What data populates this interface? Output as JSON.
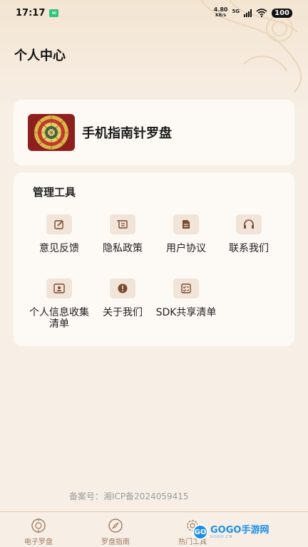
{
  "status_bar": {
    "time": "17:17",
    "net_speed_value": "4.80",
    "net_speed_unit": "KB/s",
    "net_type": "5G",
    "battery": "100"
  },
  "page_title": "个人中心",
  "app_card": {
    "name": "手机指南针罗盘"
  },
  "tools": {
    "title": "管理工具",
    "items": [
      {
        "label": "意见反馈",
        "icon": "edit-icon"
      },
      {
        "label": "隐私政策",
        "icon": "scroll-icon"
      },
      {
        "label": "用户协议",
        "icon": "document-icon"
      },
      {
        "label": "联系我们",
        "icon": "headset-icon"
      },
      {
        "label": "个人信息收集清单",
        "icon": "id-card-icon"
      },
      {
        "label": "关于我们",
        "icon": "info-icon"
      },
      {
        "label": "SDK共享清单",
        "icon": "checklist-icon"
      }
    ]
  },
  "icp": "备案号：湘ICP备2024059415",
  "bottom_nav": [
    {
      "label": "电子罗盘",
      "icon": "compass-dial-icon"
    },
    {
      "label": "罗盘指南",
      "icon": "compass-icon"
    },
    {
      "label": "热门工具",
      "icon": "gear-icon"
    }
  ],
  "watermark": {
    "brand": "GOGO手游网",
    "sub": "GOGO.CN",
    "logo_text": "GO"
  },
  "colors": {
    "accent": "#7a4a30",
    "icon_bg": "#f1e4d8",
    "nav_label": "#a07a5e"
  }
}
